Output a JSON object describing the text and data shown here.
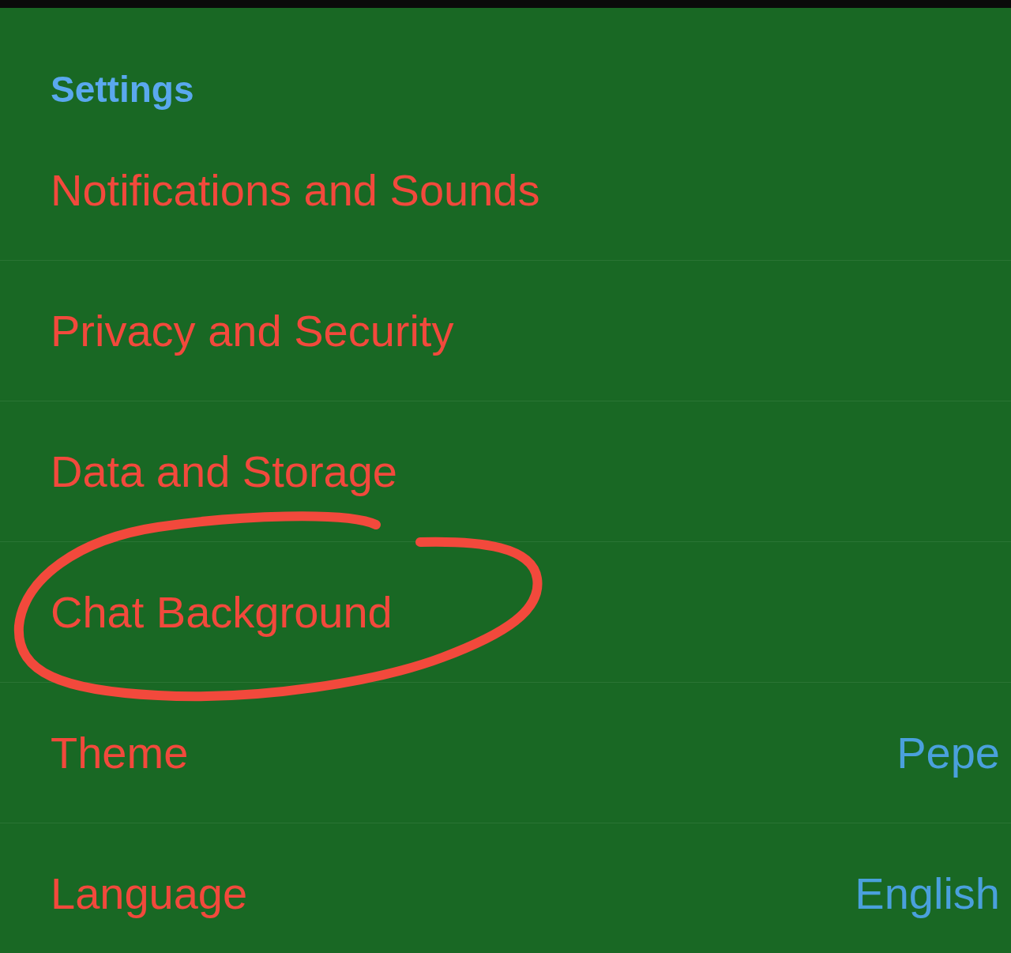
{
  "header": "Settings",
  "items": [
    {
      "label": "Notifications and Sounds",
      "circled": false
    },
    {
      "label": "Privacy and Security",
      "circled": false
    },
    {
      "label": "Data and Storage",
      "circled": false
    },
    {
      "label": "Chat Background",
      "circled": true
    },
    {
      "label": "Theme",
      "value": "Pepe",
      "circled": false
    },
    {
      "label": "Language",
      "value": "English",
      "circled": false
    }
  ]
}
